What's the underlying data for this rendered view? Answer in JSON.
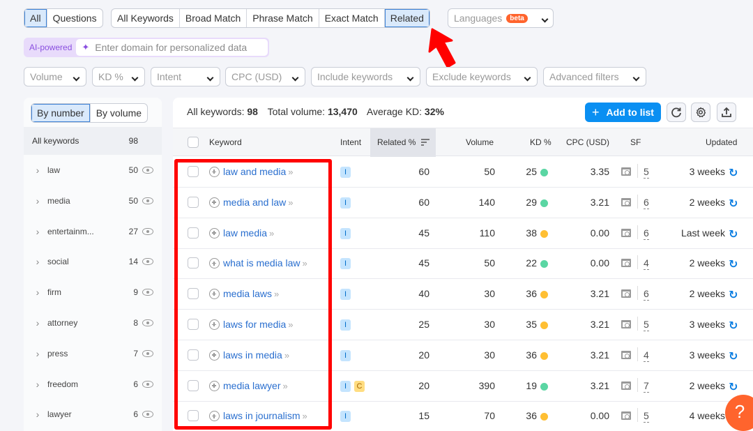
{
  "question_tabs": [
    {
      "label": "All",
      "active": true
    },
    {
      "label": "Questions",
      "active": false
    }
  ],
  "match_tabs": [
    {
      "label": "All Keywords",
      "active": false
    },
    {
      "label": "Broad Match",
      "active": false
    },
    {
      "label": "Phrase Match",
      "active": false
    },
    {
      "label": "Exact Match",
      "active": false
    },
    {
      "label": "Related",
      "active": true
    }
  ],
  "languages": {
    "label": "Languages",
    "badge": "beta"
  },
  "ai": {
    "label": "AI-powered",
    "placeholder": "Enter domain for personalized data",
    "icon": "sparkle-icon"
  },
  "filters": [
    "Volume",
    "KD %",
    "Intent",
    "CPC (USD)",
    "Include keywords",
    "Exclude keywords",
    "Advanced filters"
  ],
  "sidebar": {
    "toggle": [
      {
        "label": "By number",
        "active": true
      },
      {
        "label": "By volume",
        "active": false
      }
    ],
    "all": {
      "label": "All keywords",
      "count": "98"
    },
    "groups": [
      {
        "label": "law",
        "count": "50"
      },
      {
        "label": "media",
        "count": "50"
      },
      {
        "label": "entertainm...",
        "count": "27"
      },
      {
        "label": "social",
        "count": "14"
      },
      {
        "label": "firm",
        "count": "9"
      },
      {
        "label": "attorney",
        "count": "8"
      },
      {
        "label": "press",
        "count": "7"
      },
      {
        "label": "freedom",
        "count": "6"
      },
      {
        "label": "lawyer",
        "count": "6"
      }
    ]
  },
  "summary": {
    "all_label": "All keywords:",
    "all_value": "98",
    "volume_label": "Total volume:",
    "volume_value": "13,470",
    "kd_label": "Average KD:",
    "kd_value": "32%"
  },
  "toolbar": {
    "add_label": "Add to list",
    "add_icon": "+"
  },
  "columns": {
    "keyword": "Keyword",
    "intent": "Intent",
    "related": "Related %",
    "volume": "Volume",
    "kd": "KD %",
    "cpc": "CPC (USD)",
    "sf": "SF",
    "updated": "Updated"
  },
  "colors": {
    "kd_easy": "#5ad6a3",
    "kd_medium": "#ffbf33",
    "accent": "#0a8ff2",
    "annotation": "#ff0000"
  },
  "rows": [
    {
      "keyword": "law and media",
      "intent": [
        "I"
      ],
      "related": "60",
      "volume": "50",
      "kd": "25",
      "kd_level": "easy",
      "cpc": "3.35",
      "sf": "5",
      "updated": "3 weeks"
    },
    {
      "keyword": "media and law",
      "intent": [
        "I"
      ],
      "related": "60",
      "volume": "140",
      "kd": "29",
      "kd_level": "easy",
      "cpc": "3.21",
      "sf": "6",
      "updated": "2 weeks"
    },
    {
      "keyword": "law media",
      "intent": [
        "I"
      ],
      "related": "45",
      "volume": "110",
      "kd": "38",
      "kd_level": "medium",
      "cpc": "0.00",
      "sf": "6",
      "updated": "Last week"
    },
    {
      "keyword": "what is media law",
      "intent": [
        "I"
      ],
      "related": "45",
      "volume": "50",
      "kd": "22",
      "kd_level": "easy",
      "cpc": "0.00",
      "sf": "4",
      "updated": "2 weeks"
    },
    {
      "keyword": "media laws",
      "intent": [
        "I"
      ],
      "related": "40",
      "volume": "30",
      "kd": "36",
      "kd_level": "medium",
      "cpc": "3.21",
      "sf": "6",
      "updated": "2 weeks"
    },
    {
      "keyword": "laws for media",
      "intent": [
        "I"
      ],
      "related": "25",
      "volume": "30",
      "kd": "35",
      "kd_level": "medium",
      "cpc": "3.21",
      "sf": "5",
      "updated": "3 weeks"
    },
    {
      "keyword": "laws in media",
      "intent": [
        "I"
      ],
      "related": "20",
      "volume": "30",
      "kd": "36",
      "kd_level": "medium",
      "cpc": "3.21",
      "sf": "4",
      "updated": "3 weeks"
    },
    {
      "keyword": "media lawyer",
      "intent": [
        "I",
        "C"
      ],
      "related": "20",
      "volume": "390",
      "kd": "19",
      "kd_level": "easy",
      "cpc": "3.21",
      "sf": "7",
      "updated": "2 weeks"
    },
    {
      "keyword": "laws in journalism",
      "intent": [
        "I"
      ],
      "related": "15",
      "volume": "70",
      "kd": "36",
      "kd_level": "medium",
      "cpc": "0.00",
      "sf": "5",
      "updated": "4 weeks"
    }
  ],
  "help": "?"
}
